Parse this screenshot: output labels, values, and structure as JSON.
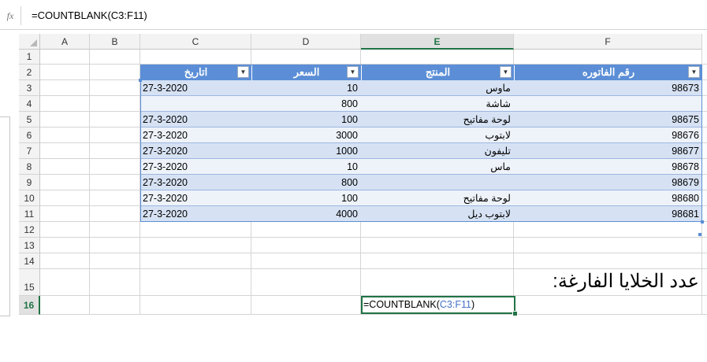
{
  "formula_bar": {
    "fx_label": "fx",
    "formula": "=COUNTBLANK(C3:F11)"
  },
  "columns": [
    "A",
    "B",
    "C",
    "D",
    "E",
    "F"
  ],
  "selected_column": "E",
  "rows": [
    "1",
    "2",
    "3",
    "4",
    "5",
    "6",
    "7",
    "8",
    "9",
    "10",
    "11",
    "12",
    "13",
    "14",
    "15",
    "16"
  ],
  "selected_row": "16",
  "table": {
    "headers": {
      "date": "اتاريخ",
      "price": "السعر",
      "product": "المنتج",
      "invoice": "رقم الفاتوره"
    },
    "dropdown_icon": "chevron-down-icon",
    "records": [
      {
        "date": "27-3-2020",
        "price": "10",
        "product": "ماوس",
        "invoice": "98673"
      },
      {
        "date": "",
        "price": "800",
        "product": "شاشة",
        "invoice": ""
      },
      {
        "date": "27-3-2020",
        "price": "100",
        "product": "لوحة مفاتيح",
        "invoice": "98675"
      },
      {
        "date": "27-3-2020",
        "price": "3000",
        "product": "لابتوب",
        "invoice": "98676"
      },
      {
        "date": "27-3-2020",
        "price": "1000",
        "product": "تليفون",
        "invoice": "98677"
      },
      {
        "date": "27-3-2020",
        "price": "10",
        "product": "ماس",
        "invoice": "98678"
      },
      {
        "date": "27-3-2020",
        "price": "800",
        "product": "",
        "invoice": "98679"
      },
      {
        "date": "27-3-2020",
        "price": "100",
        "product": "لوحة مفاتيح",
        "invoice": "98680"
      },
      {
        "date": "27-3-2020",
        "price": "4000",
        "product": "لابتوب ديل",
        "invoice": "98681"
      }
    ]
  },
  "blank_cells_label": "عدد الخلايا الفارغة:",
  "active_cell": {
    "prefix": "=COUNTBLANK(",
    "range": "C3:F11",
    "suffix": ")"
  },
  "colors": {
    "header_blue": "#5b8ed6",
    "band_dark": "#d6e2f3",
    "band_light": "#eef3fa",
    "excel_green": "#217346",
    "range_ref_blue": "#4472c4"
  }
}
